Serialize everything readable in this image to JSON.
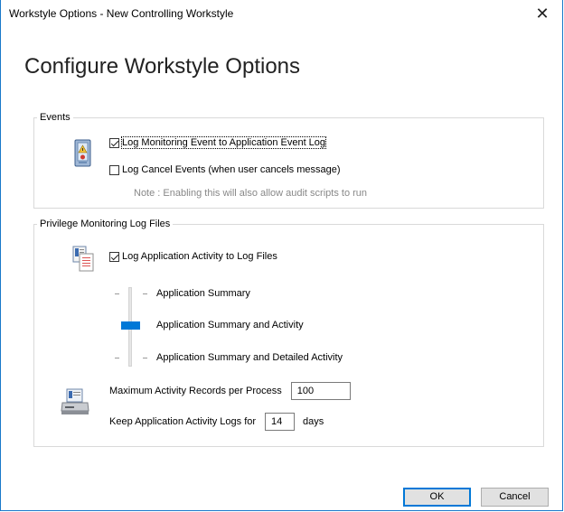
{
  "window": {
    "title": "Workstyle Options - New Controlling Workstyle",
    "close_glyph": "✕"
  },
  "header": "Configure Workstyle Options",
  "events": {
    "legend": "Events",
    "log_monitoring": {
      "label": "Log Monitoring Event to Application Event Log",
      "checked": true
    },
    "log_cancel": {
      "label": "Log Cancel Events (when user cancels message)",
      "checked": false
    },
    "note": "Note : Enabling this will also allow audit scripts to run"
  },
  "privilege": {
    "legend": "Privilege Monitoring Log Files",
    "log_activity": {
      "label": "Log Application Activity to Log Files",
      "checked": true
    },
    "levels": [
      "Application Summary",
      "Application Summary and Activity",
      "Application Summary and Detailed Activity"
    ],
    "selected_level_index": 1,
    "max_records_label": "Maximum Activity Records per Process",
    "max_records_value": "100",
    "keep_logs_label": "Keep Application Activity Logs for",
    "keep_logs_value": "14",
    "keep_logs_unit": "days"
  },
  "buttons": {
    "ok": "OK",
    "cancel": "Cancel"
  }
}
